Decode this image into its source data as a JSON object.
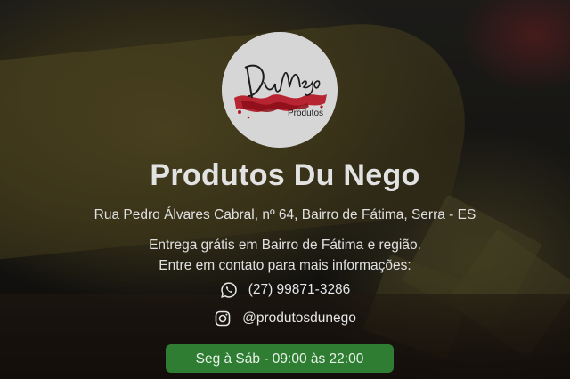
{
  "logo": {
    "script_text": "DuNego",
    "sub_text": "Produtos"
  },
  "shop": {
    "name": "Produtos Du Nego",
    "address": "Rua Pedro Álvares Cabral, nº 64, Bairro de Fátima, Serra - ES",
    "delivery_line1": "Entrega grátis em Bairro de Fátima e região.",
    "delivery_line2": "Entre em contato para mais informações:"
  },
  "contact": {
    "phone": "(27) 99871-3286",
    "phone_icon": "whatsapp-icon",
    "instagram": "@produtosdunego",
    "instagram_icon": "instagram-icon"
  },
  "hours": {
    "label": "Seg à Sáb - 09:00 às 22:00"
  },
  "colors": {
    "accent_green": "#2e7d32",
    "logo_red": "#b3121f",
    "text_light": "#e6e6e6"
  }
}
